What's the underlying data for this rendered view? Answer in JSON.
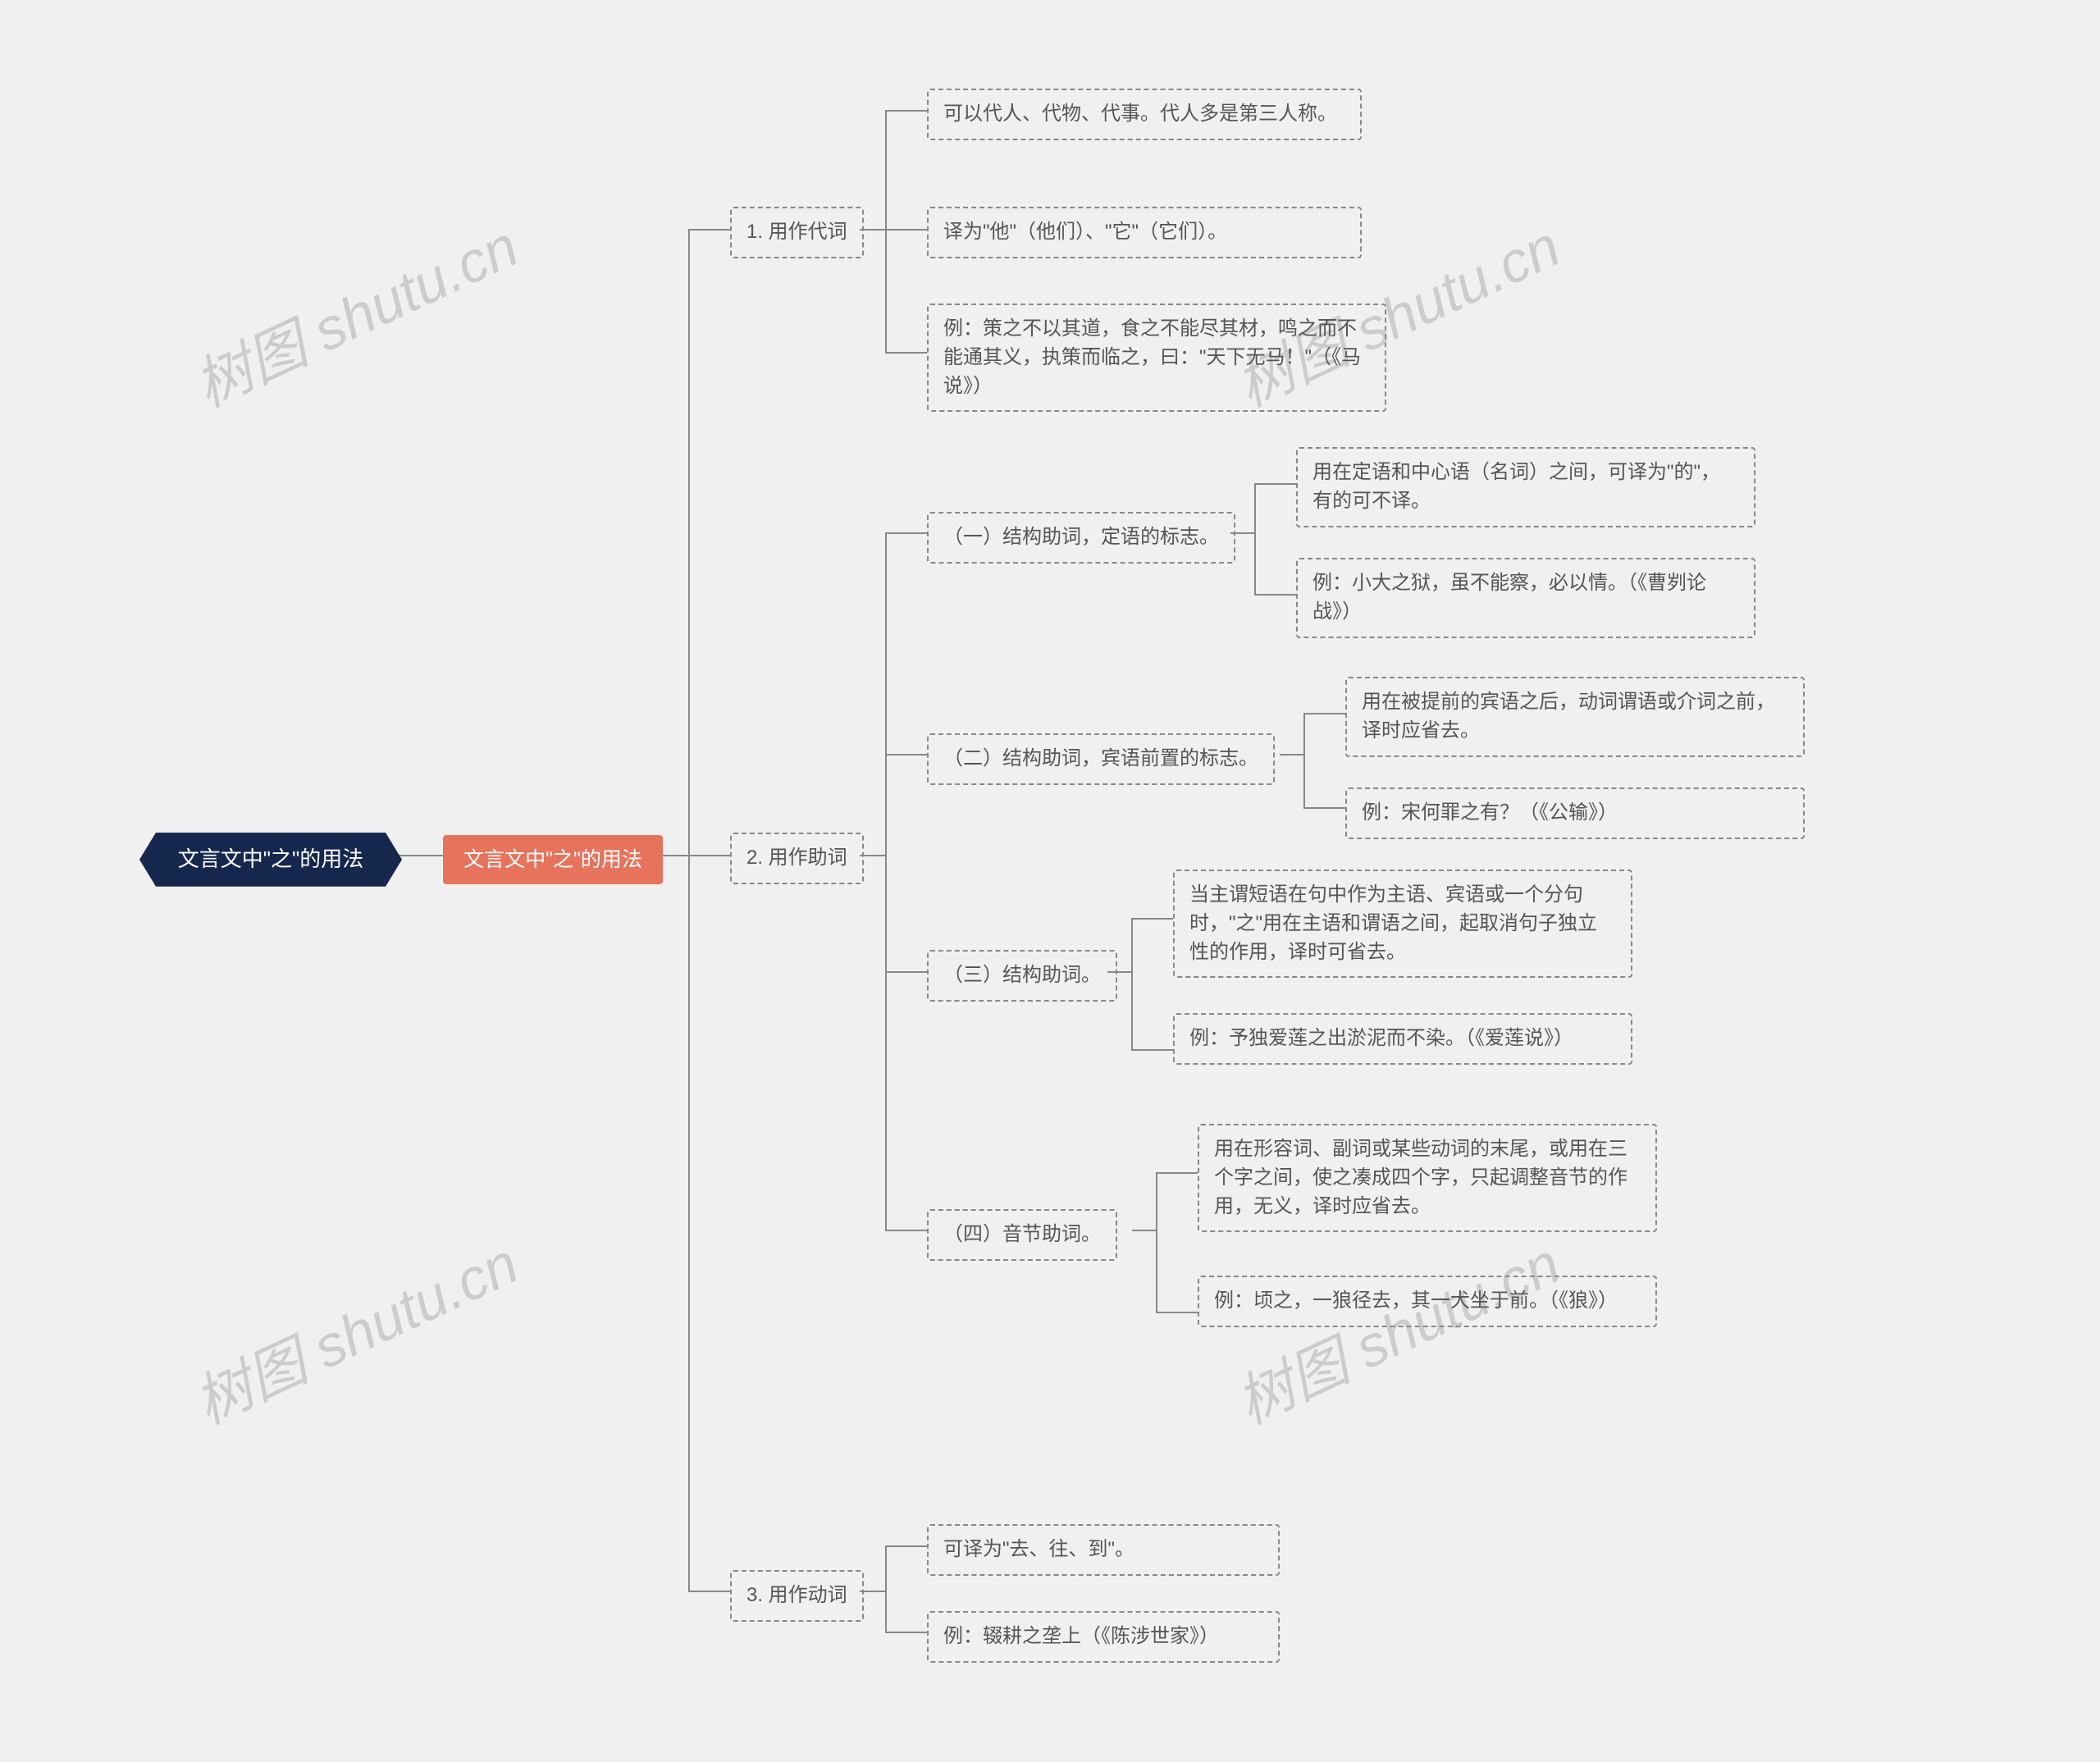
{
  "chart_data": {
    "type": "mindmap",
    "title": "文言文中\"之\"的用法",
    "root": {
      "label": "文言文中\"之\"的用法",
      "children": [
        {
          "label": "文言文中\"之\"的用法",
          "children": [
            {
              "label": "1. 用作代词",
              "children": [
                {
                  "label": "可以代人、代物、代事。代人多是第三人称。"
                },
                {
                  "label": "译为\"他\"（他们）、\"它\"（它们）。"
                },
                {
                  "label": "例：策之不以其道，食之不能尽其材，鸣之而不能通其义，执策而临之，曰：\"天下无马！\"（《马说》）"
                }
              ]
            },
            {
              "label": "2. 用作助词",
              "children": [
                {
                  "label": "（一）结构助词，定语的标志。",
                  "children": [
                    {
                      "label": "用在定语和中心语（名词）之间，可译为\"的\"，有的可不译。"
                    },
                    {
                      "label": "例：小大之狱，虽不能察，必以情。（《曹刿论战》）"
                    }
                  ]
                },
                {
                  "label": "（二）结构助词，宾语前置的标志。",
                  "children": [
                    {
                      "label": "用在被提前的宾语之后，动词谓语或介词之前，译时应省去。"
                    },
                    {
                      "label": "例：宋何罪之有？（《公输》）"
                    }
                  ]
                },
                {
                  "label": "（三）结构助词。",
                  "children": [
                    {
                      "label": "当主谓短语在句中作为主语、宾语或一个分句时，\"之\"用在主语和谓语之间，起取消句子独立性的作用，译时可省去。"
                    },
                    {
                      "label": "例：予独爱莲之出淤泥而不染。（《爱莲说》）"
                    }
                  ]
                },
                {
                  "label": "（四）音节助词。",
                  "children": [
                    {
                      "label": "用在形容词、副词或某些动词的末尾，或用在三个字之间，使之凑成四个字，只起调整音节的作用，无义，译时应省去。"
                    },
                    {
                      "label": "例：顷之，一狼径去，其一犬坐于前。（《狼》）"
                    }
                  ]
                }
              ]
            },
            {
              "label": "3. 用作动词",
              "children": [
                {
                  "label": "可译为\"去、往、到\"。"
                },
                {
                  "label": "例：辍耕之垄上（《陈涉世家》）"
                }
              ]
            }
          ]
        }
      ]
    }
  },
  "watermark": "树图 shutu.cn",
  "root": {
    "label": "文言文中\"之\"的用法"
  },
  "sub1": {
    "label": "文言文中\"之\"的用法"
  },
  "b1": {
    "label": "1. 用作代词"
  },
  "b1c1": {
    "label": "可以代人、代物、代事。代人多是第三人称。"
  },
  "b1c2": {
    "label": "译为\"他\"（他们）、\"它\"（它们）。"
  },
  "b1c3": {
    "label": "例：策之不以其道，食之不能尽其材，鸣之而不能通其义，执策而临之，曰：\"天下无马！\"（《马说》）"
  },
  "b2": {
    "label": "2. 用作助词"
  },
  "b2a": {
    "label": "（一）结构助词，定语的标志。"
  },
  "b2a1": {
    "label": "用在定语和中心语（名词）之间，可译为\"的\"，有的可不译。"
  },
  "b2a2": {
    "label": "例：小大之狱，虽不能察，必以情。（《曹刿论战》）"
  },
  "b2b": {
    "label": "（二）结构助词，宾语前置的标志。"
  },
  "b2b1": {
    "label": "用在被提前的宾语之后，动词谓语或介词之前，译时应省去。"
  },
  "b2b2": {
    "label": "例：宋何罪之有？（《公输》）"
  },
  "b2c": {
    "label": "（三）结构助词。"
  },
  "b2c1": {
    "label": "当主谓短语在句中作为主语、宾语或一个分句时，\"之\"用在主语和谓语之间，起取消句子独立性的作用，译时可省去。"
  },
  "b2c2": {
    "label": "例：予独爱莲之出淤泥而不染。（《爱莲说》）"
  },
  "b2d": {
    "label": "（四）音节助词。"
  },
  "b2d1": {
    "label": "用在形容词、副词或某些动词的末尾，或用在三个字之间，使之凑成四个字，只起调整音节的作用，无义，译时应省去。"
  },
  "b2d2": {
    "label": "例：顷之，一狼径去，其一犬坐于前。（《狼》）"
  },
  "b3": {
    "label": "3. 用作动词"
  },
  "b3c1": {
    "label": "可译为\"去、往、到\"。"
  },
  "b3c2": {
    "label": "例：辍耕之垄上（《陈涉世家》）"
  }
}
